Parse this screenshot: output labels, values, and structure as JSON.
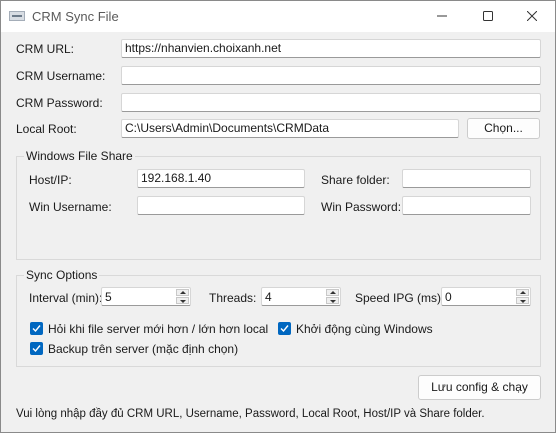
{
  "window": {
    "title": "CRM Sync File"
  },
  "form": {
    "crm_url_label": "CRM URL:",
    "crm_url_value": "https://nhanvien.choixanh.net",
    "crm_username_label": "CRM Username:",
    "crm_username_value": "",
    "crm_password_label": "CRM Password:",
    "crm_password_value": "",
    "local_root_label": "Local Root:",
    "local_root_value": "C:\\Users\\Admin\\Documents\\CRMData",
    "choose_button_label": "Chọn..."
  },
  "file_share": {
    "title": "Windows File Share",
    "host_label": "Host/IP:",
    "host_value": "192.168.1.40",
    "share_folder_label": "Share folder:",
    "share_folder_value": "",
    "win_username_label": "Win Username:",
    "win_username_value": "",
    "win_password_label": "Win Password:",
    "win_password_value": ""
  },
  "sync_options": {
    "title": "Sync Options",
    "interval_label": "Interval (min):",
    "interval_value": "5",
    "threads_label": "Threads:",
    "threads_value": "4",
    "speed_label": "Speed IPG (ms):",
    "speed_value": "0",
    "checkboxes": [
      {
        "label": "Hỏi khi file server mới hơn / lớn hơn local",
        "checked": true
      },
      {
        "label": "Khởi động cùng Windows",
        "checked": true
      },
      {
        "label": "Backup trên server (mặc định chọn)",
        "checked": true
      }
    ]
  },
  "actions": {
    "save_run_label": "Lưu config & chạy"
  },
  "status": {
    "message": "Vui lòng nhập đầy đủ CRM URL, Username, Password, Local Root, Host/IP và Share folder."
  },
  "colors": {
    "accent": "#0067c0",
    "window_bg": "#f0f0f0"
  }
}
